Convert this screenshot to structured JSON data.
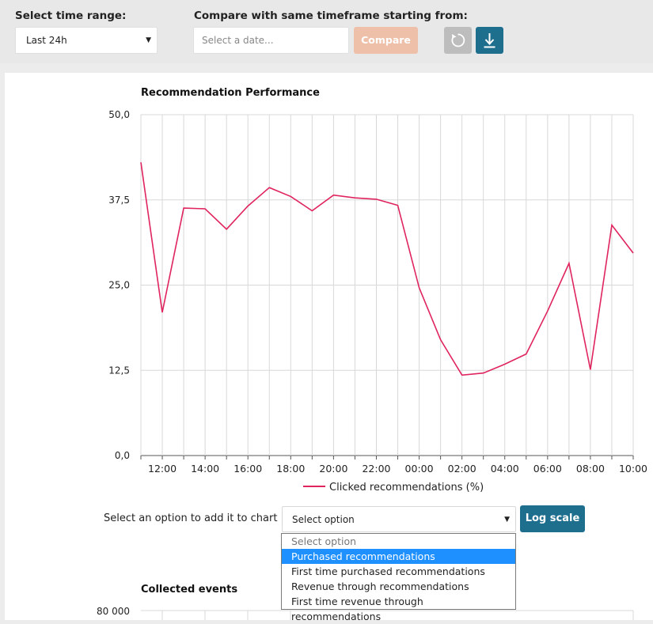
{
  "toolbar": {
    "time_range_label": "Select time range:",
    "time_range_value": "Last 24h",
    "compare_label": "Compare with same timeframe starting from:",
    "date_placeholder": "Select a date...",
    "compare_button": "Compare",
    "reset_icon": "refresh-icon",
    "download_icon": "download-icon"
  },
  "chart1": {
    "title": "Recommendation Performance",
    "legend": "Clicked recommendations (%)",
    "y_ticks": [
      "0,0",
      "12,5",
      "25,0",
      "37,5",
      "50,0"
    ],
    "x_ticks": [
      "12:00",
      "14:00",
      "16:00",
      "18:00",
      "20:00",
      "22:00",
      "00:00",
      "02:00",
      "04:00",
      "06:00",
      "08:00",
      "10:00"
    ]
  },
  "chart_data": {
    "type": "line",
    "title": "Recommendation Performance",
    "x": [
      "11:00",
      "12:00",
      "13:00",
      "14:00",
      "15:00",
      "16:00",
      "17:00",
      "18:00",
      "19:00",
      "20:00",
      "21:00",
      "22:00",
      "23:00",
      "00:00",
      "01:00",
      "02:00",
      "03:00",
      "04:00",
      "05:00",
      "06:00",
      "07:00",
      "08:00",
      "09:00",
      "10:00"
    ],
    "series": [
      {
        "name": "Clicked recommendations (%)",
        "values": [
          43.0,
          21.0,
          36.3,
          36.2,
          33.2,
          36.6,
          39.3,
          38.0,
          35.9,
          38.2,
          37.8,
          37.6,
          36.7,
          24.6,
          17.0,
          11.8,
          12.1,
          13.4,
          14.9,
          21.2,
          28.2,
          12.6,
          33.8,
          29.7
        ]
      }
    ],
    "ylim": [
      0,
      50
    ],
    "grid": true,
    "legend_position": "bottom"
  },
  "options": {
    "label": "Select an option to add it to chart :",
    "selected": "Select option",
    "items": [
      "Select option",
      "Purchased recommendations",
      "First time purchased recommendations",
      "Revenue through recommendations",
      "First time revenue through recommendations"
    ],
    "log_button": "Log scale"
  },
  "chart2": {
    "title": "Collected events",
    "y_top": "80 000"
  },
  "colors": {
    "line": "#e0245e",
    "accent": "#1e6e8e",
    "compare": "#efc0a9",
    "highlight": "#1e90ff"
  }
}
